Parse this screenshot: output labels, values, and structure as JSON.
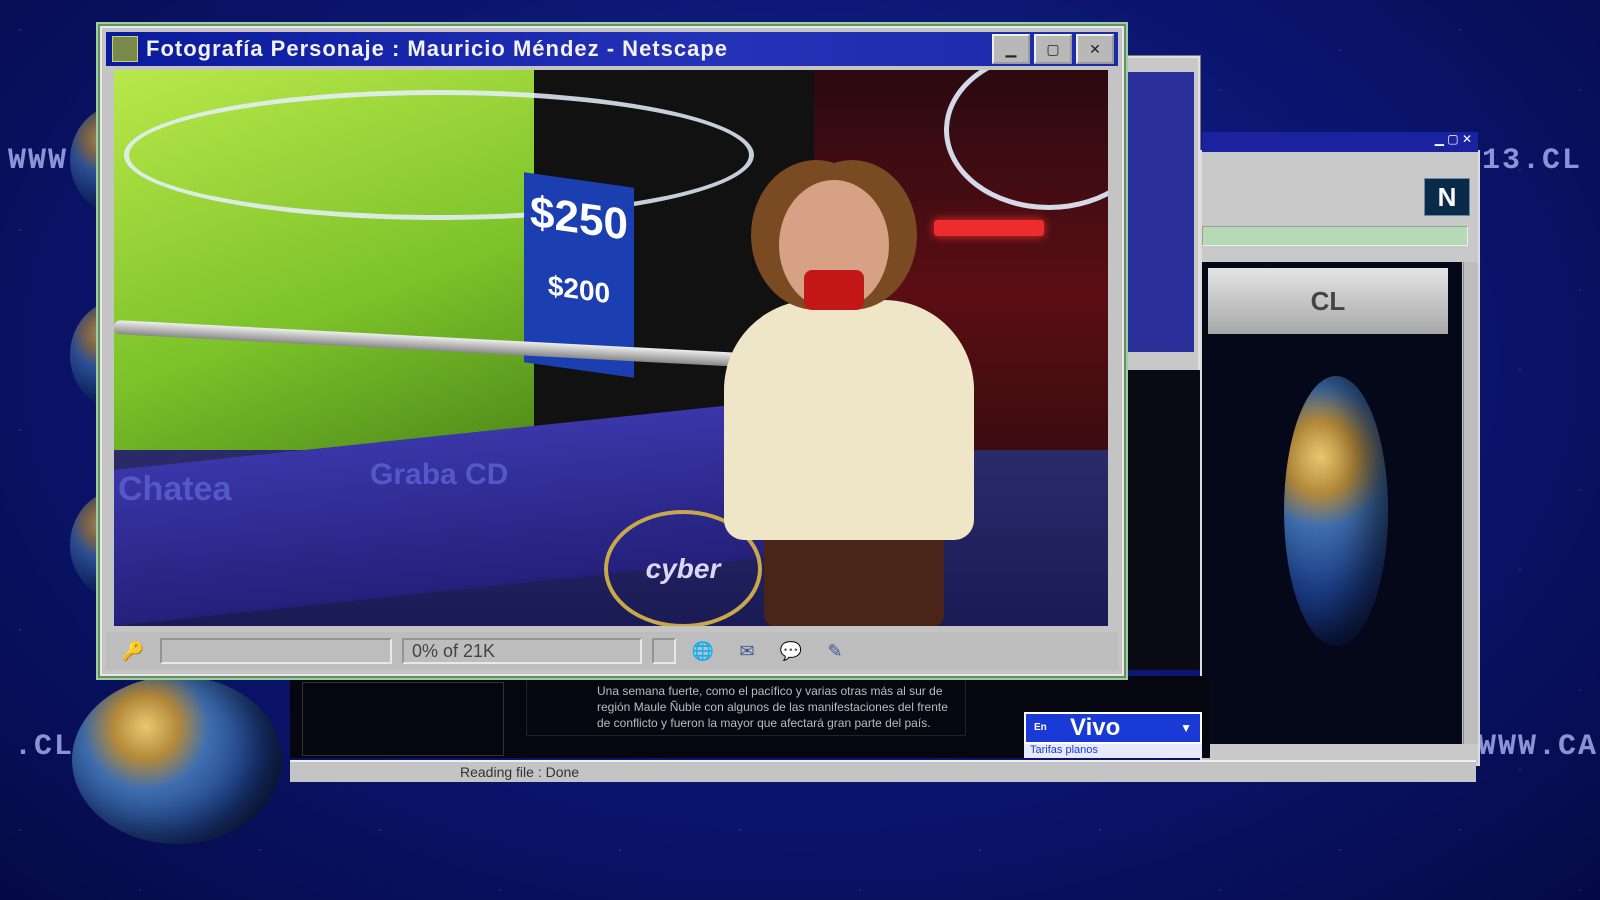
{
  "main_window": {
    "title": "Fotografía Personaje : Mauricio Méndez - Netscape",
    "status_progress": "0% of 21K",
    "buttons": {
      "minimize": "▁",
      "maximize": "▢",
      "close": "✕"
    }
  },
  "scene_text": {
    "price_main": "$250",
    "price_sub": "$200",
    "chatea": "Chatea",
    "graba_cd": "Graba CD",
    "cyber_logo": "cyber"
  },
  "background": {
    "ticker_left_top": "WWW",
    "ticker_right_top": "13.CL",
    "ticker_left_bottom": ".CL",
    "ticker_right_bottom": "WWW.CA"
  },
  "right_window": {
    "logo_letter": "N",
    "site_logo_text": "CL"
  },
  "lower_panel": {
    "article_text": "Una semana fuerte, como el pacífico y varias otras más al sur de región Maule Ñuble con algunos de las manifestaciones del frente de conflicto y fueron la mayor que afectará gran parte del país.",
    "en_vivo_prefix": "En",
    "en_vivo_label": "Vivo",
    "dropdown_item": "Tarifas planos",
    "status_text": "Reading file : Done"
  },
  "colors": {
    "titlebar": "#1a2aa8",
    "background": "#0b1570",
    "en_vivo": "#1a3ad8"
  }
}
